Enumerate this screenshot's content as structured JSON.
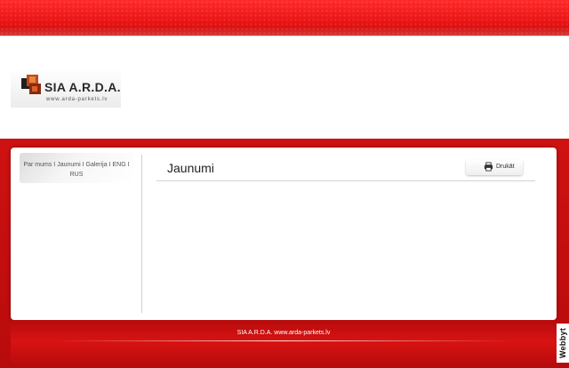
{
  "logo": {
    "name": "SIA  A.R.D.A.",
    "url": "www.arda-parkets.lv"
  },
  "nav": {
    "items": [
      "Par mums",
      "Jaunumi",
      "Galerija",
      "ENG",
      "RUS"
    ],
    "separator": "I"
  },
  "page": {
    "title": "Jaunumi",
    "print_label": "Drukāt"
  },
  "footer": {
    "text": "SIA A.R.D.A. www.arda-parkets.lv"
  },
  "badge": {
    "text": "Webbyt"
  },
  "colors": {
    "brand_red": "#c40d0d",
    "top_bar": "#ea1414",
    "content_bg": "#ffffff"
  },
  "icons": {
    "print": "printer-icon",
    "logo_mark": "arda-logo-mark"
  }
}
